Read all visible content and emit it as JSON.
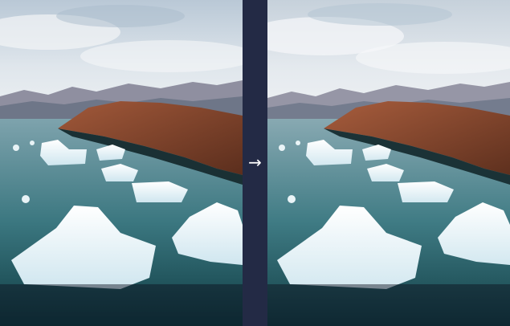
{
  "comparison": {
    "left_image": {
      "icon": "glacier-photo",
      "description_hidden": true
    },
    "right_image": {
      "icon": "glacier-photo",
      "description_hidden": true
    },
    "divider_arrow": {
      "glyph": "→",
      "icon": "arrow-right-icon"
    }
  },
  "colors": {
    "background": "#232a45",
    "sky": "#c9d4de",
    "water": "#2f6f78",
    "cliff": "#8a4a2f"
  }
}
